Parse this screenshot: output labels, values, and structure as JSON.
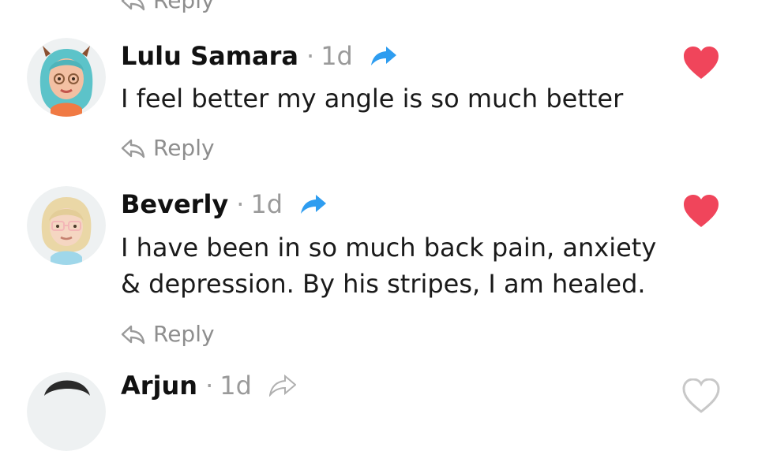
{
  "top_reply": {
    "label": "Reply"
  },
  "comments": [
    {
      "author": "Lulu Samara",
      "separator": "·",
      "time": "1d",
      "text": "I feel better my angle is so much better",
      "reply_label": "Reply",
      "liked": true,
      "avatar_icon": "bitmoji-teal-hair-avatar"
    },
    {
      "author": "Beverly",
      "separator": "·",
      "time": "1d",
      "text": "I have been in so much back pain, anxiety & depression. By his stripes, I am healed.",
      "reply_label": "Reply",
      "liked": true,
      "avatar_icon": "bitmoji-blonde-glasses-avatar"
    },
    {
      "author": "Arjun",
      "separator": "·",
      "time": "1d",
      "liked": false
    }
  ],
  "colors": {
    "heart": "#f0455b",
    "share": "#2e9df0",
    "muted": "#8e8e8e"
  }
}
